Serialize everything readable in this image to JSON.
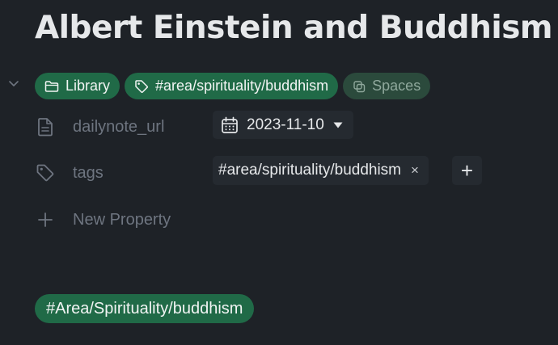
{
  "page": {
    "title": "Albert Einstein and Buddhism"
  },
  "chips": [
    {
      "label": "Library",
      "icon": "folder-icon"
    },
    {
      "label": "#area/spirituality/buddhism",
      "icon": "tag-icon"
    },
    {
      "label": "Spaces",
      "icon": "spaces-icon"
    }
  ],
  "properties": {
    "dailynote_url": {
      "label": "dailynote_url",
      "value": "2023-11-10",
      "icon": "document-icon"
    },
    "tags": {
      "label": "tags",
      "value": "#area/spirituality/buddhism",
      "remove": "×",
      "add": "+",
      "icon": "tag-icon"
    },
    "new_property": {
      "label": "New Property",
      "icon": "plus-icon"
    }
  },
  "body_tag": "#Area/Spirituality/buddhism",
  "colors": {
    "background": "#1e2227",
    "chip_green": "#206a47",
    "chip_muted": "#2b4a3c",
    "value_box": "#252a30",
    "muted_text": "#6e7580"
  }
}
